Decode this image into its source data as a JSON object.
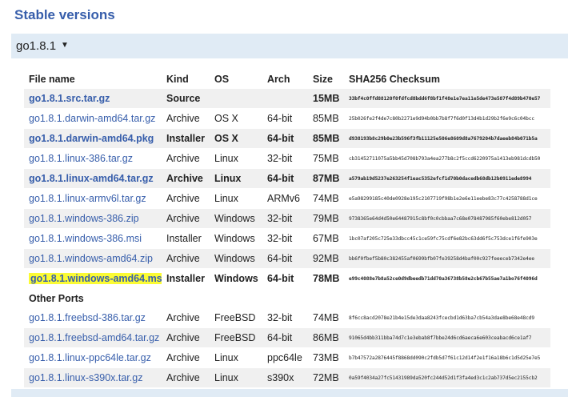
{
  "page": {
    "title": "Stable versions"
  },
  "version_selector": {
    "label": "go1.8.1",
    "caret": "▼"
  },
  "table": {
    "headers": [
      "File name",
      "Kind",
      "OS",
      "Arch",
      "Size",
      "SHA256 Checksum"
    ],
    "rows": [
      {
        "file": "go1.8.1.src.tar.gz",
        "kind": "Source",
        "os": "",
        "arch": "",
        "size": "15MB",
        "sha": "33bf4c0ffd88120f0fdfcd8bdd6f8bf1f48e1e7ea11e5de473e587f4d89b470e57",
        "highlight": true
      },
      {
        "file": "go1.8.1.darwin-amd64.tar.gz",
        "kind": "Archive",
        "os": "OS X",
        "arch": "64-bit",
        "size": "85MB",
        "sha": "25b026fe2f4de7c80b2271e9d94b0bb7b8f7f6d0f13d4b1d29b2f6e9c6c04bcc",
        "highlight": false
      },
      {
        "file": "go1.8.1.darwin-amd64.pkg",
        "kind": "Installer",
        "os": "OS X",
        "arch": "64-bit",
        "size": "85MB",
        "sha": "d938193b8c29b0e23b596f3fb11125e506e8609d8a7679204b7daeeb84b071b5a",
        "highlight": true
      },
      {
        "file": "go1.8.1.linux-386.tar.gz",
        "kind": "Archive",
        "os": "Linux",
        "arch": "32-bit",
        "size": "75MB",
        "sha": "cb31452711075a5bb45d708b793a4ea277b8c2f5ccd6220975a1413eb981dcdb50",
        "highlight": false
      },
      {
        "file": "go1.8.1.linux-amd64.tar.gz",
        "kind": "Archive",
        "os": "Linux",
        "arch": "64-bit",
        "size": "87MB",
        "sha": "a579ab19d5237e263254f1eac5352efcf1d70b0dacedb68db12b0911ede8994",
        "highlight": true
      },
      {
        "file": "go1.8.1.linux-armv6l.tar.gz",
        "kind": "Archive",
        "os": "Linux",
        "arch": "ARMv6",
        "size": "74MB",
        "sha": "e5a98299185c40de0928e195c2107719f98b1e2e6e11eebe83c77c4258788d1ce",
        "highlight": false
      },
      {
        "file": "go1.8.1.windows-386.zip",
        "kind": "Archive",
        "os": "Windows",
        "arch": "32-bit",
        "size": "79MB",
        "sha": "9738365e64d4d50e64487915c8bf0c0cbbaa7c68e078487985f60ebe812d057",
        "highlight": false
      },
      {
        "file": "go1.8.1.windows-386.msi",
        "kind": "Installer",
        "os": "Windows",
        "arch": "32-bit",
        "size": "67MB",
        "sha": "1bc07af205c725e33dbcc45c1ce59fc75cdf6e82bc63dd6f5c753dce1f6fe903e",
        "highlight": false
      },
      {
        "file": "go1.8.1.windows-amd64.zip",
        "kind": "Archive",
        "os": "Windows",
        "arch": "64-bit",
        "size": "92MB",
        "sha": "bb6f0fbef5b80c382455af0699bfb07fe39258d4baf00c927feeeceb7342e4ee",
        "highlight": false
      },
      {
        "file": "go1.8.1.windows-amd64.msi",
        "kind": "Installer",
        "os": "Windows",
        "arch": "64-bit",
        "size": "78MB",
        "sha": "e99c4088e7b8a52ce0d9dbeedb71dd70a36738b58e2cb67b55ae7a1bo76f4096d",
        "highlight": true,
        "marked": true
      }
    ],
    "other_ports_label": "Other Ports",
    "other_rows": [
      {
        "file": "go1.8.1.freebsd-386.tar.gz",
        "kind": "Archive",
        "os": "FreeBSD",
        "arch": "32-bit",
        "size": "74MB",
        "sha": "8f6cc8acd2078e21b4e15de3daa8243fcecbd1d63ba7cb54a3dae8be68e48cd9"
      },
      {
        "file": "go1.8.1.freebsd-amd64.tar.gz",
        "kind": "Archive",
        "os": "FreeBSD",
        "arch": "64-bit",
        "size": "86MB",
        "sha": "91065d4bb311bba74d7c1e3ebab8f7bbe24d6cd6aeca6e603ceabacd6ce1af7"
      },
      {
        "file": "go1.8.1.linux-ppc64le.tar.gz",
        "kind": "Archive",
        "os": "Linux",
        "arch": "ppc64le",
        "size": "73MB",
        "sha": "b7b47572a2876445f8868dd090c2fdb5d7f61c12d14f2e1f16a18b6c1d5d25e7e5"
      },
      {
        "file": "go1.8.1.linux-s390x.tar.gz",
        "kind": "Archive",
        "os": "Linux",
        "arch": "s390x",
        "size": "72MB",
        "sha": "0a59f4034a27fc51431989da520fc244d52d1f3fa4ed3c1c2ab737d5ec2155cb2"
      }
    ]
  }
}
